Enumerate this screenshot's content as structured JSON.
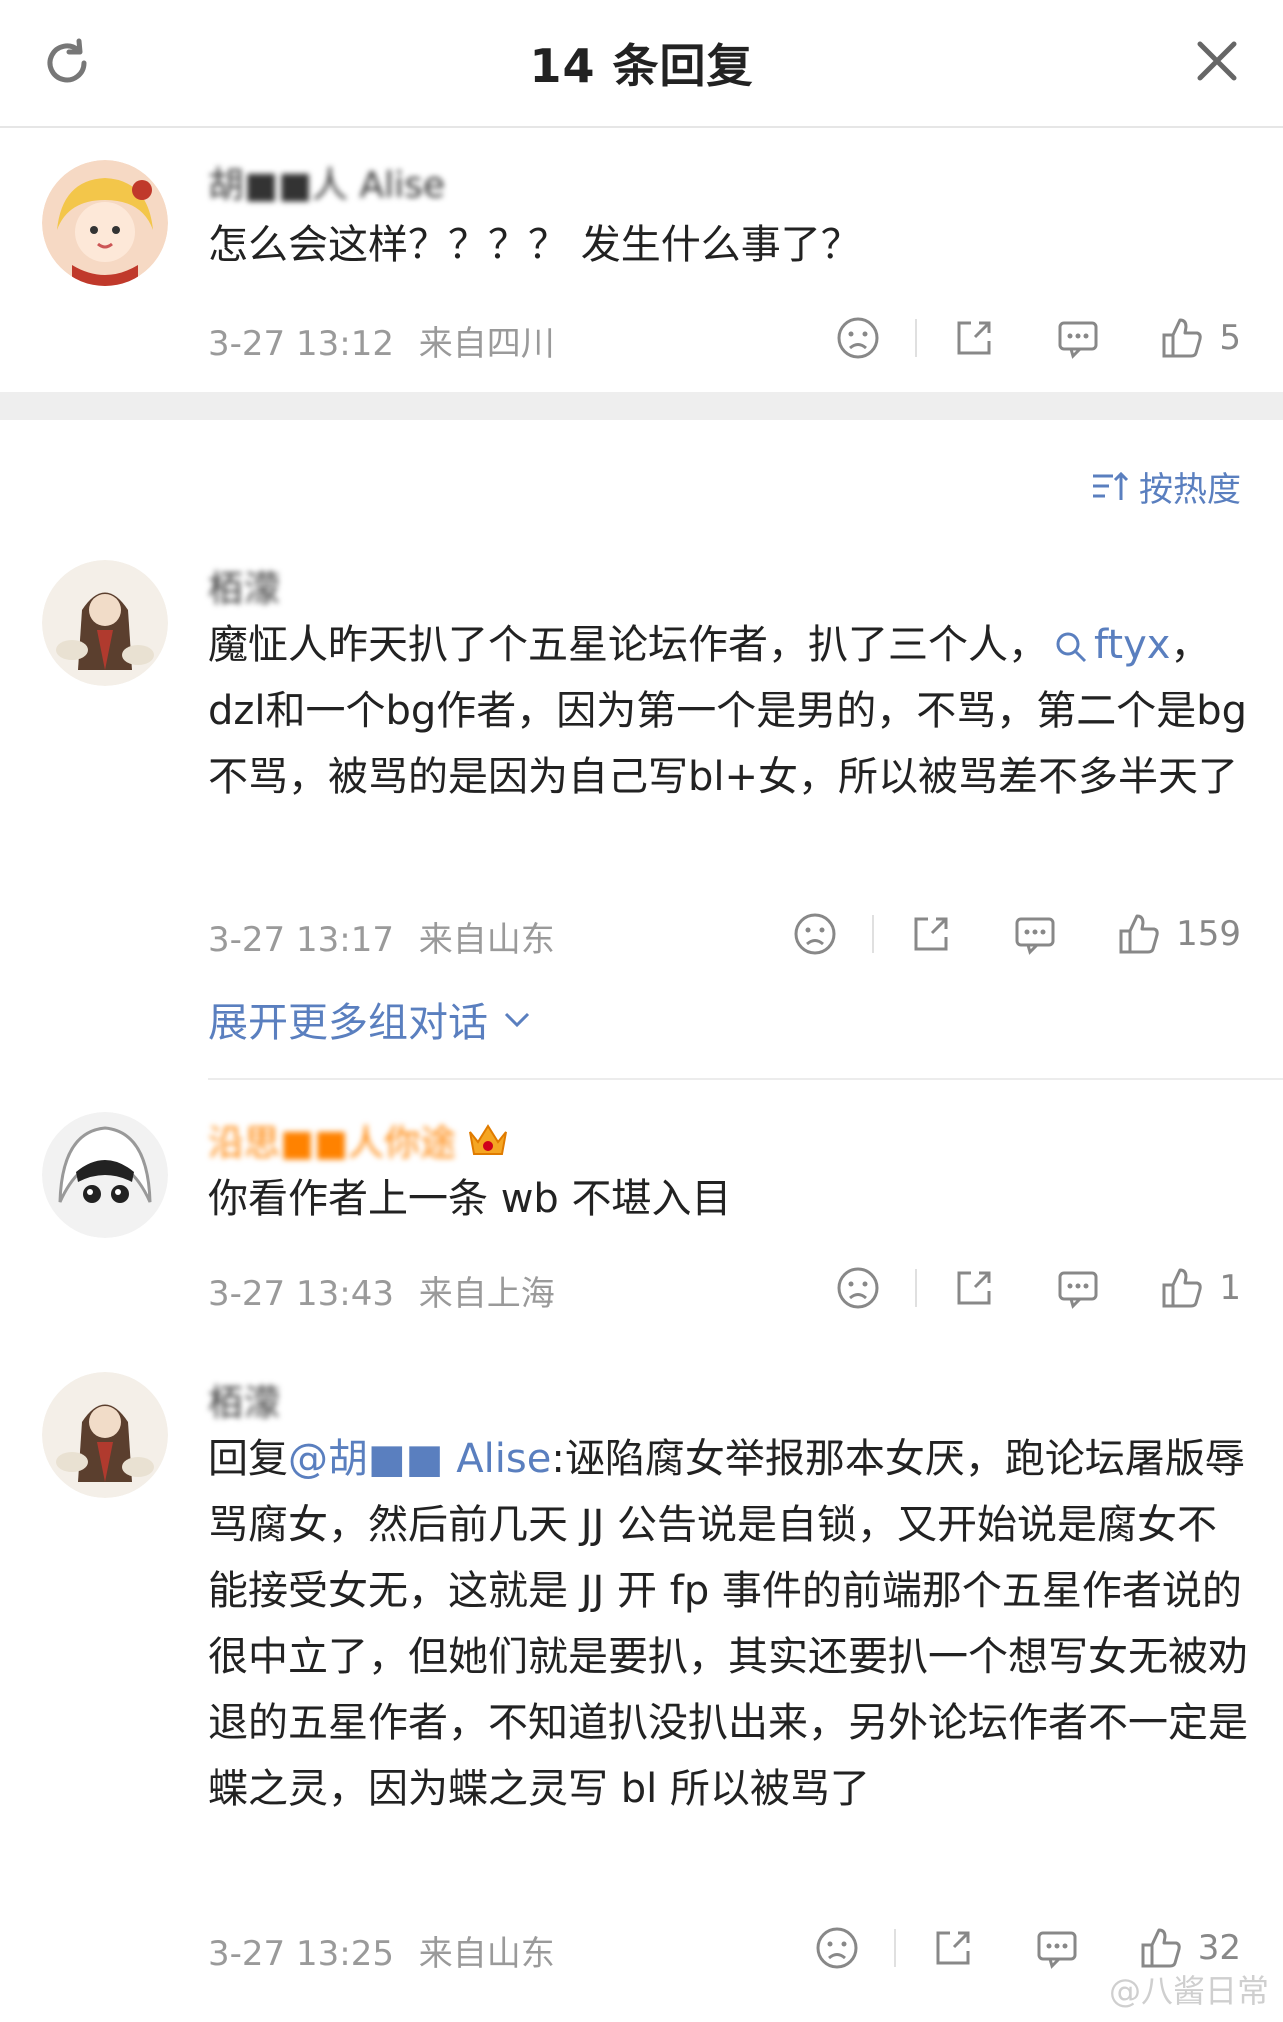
{
  "header": {
    "title": "14 条回复"
  },
  "root_comment": {
    "username": "胡■■人 Alise",
    "text": "怎么会这样？？？？ 发生什么事了？",
    "time": "3-27 13:12",
    "location": "来自四川",
    "likes": "5"
  },
  "sort": {
    "label": "按热度"
  },
  "replies": [
    {
      "username": "栢濛",
      "text_before": "魔怔人昨天扒了个五星论坛作者，扒了三个人，",
      "link": "ftyx",
      "text_after": "，dzl和一个bg作者，因为第一个是男的，不骂，第二个是bg不骂，被骂的是因为自己写bl+女，所以被骂差不多半天了",
      "time": "3-27 13:17",
      "location": "来自山东",
      "likes": "159",
      "expand": "展开更多组对话"
    },
    {
      "username": "沿思■■人你途",
      "text": "你看作者上一条 wb 不堪入目",
      "time": "3-27 13:43",
      "location": "来自上海",
      "likes": "1"
    },
    {
      "username": "栢濛",
      "reply_prefix": "回复",
      "mention": "@胡■■ Alise",
      "text": ":诬陷腐女举报那本女厌，跑论坛屠版辱骂腐女，然后前几天 JJ 公告说是自锁，又开始说是腐女不能接受女无，这就是 JJ 开 fp 事件的前端那个五星作者说的很中立了，但她们就是要扒，其实还要扒一个想写女无被劝退的五星作者，不知道扒没扒出来，另外论坛作者不一定是蝶之灵，因为蝶之灵写 bl 所以被骂了",
      "time": "3-27 13:25",
      "location": "来自山东",
      "likes": "32"
    }
  ],
  "watermark": "@八酱日常",
  "colors": {
    "link": "#5a7fbf",
    "orange_name": "#ff8200",
    "meta": "#9a9a9a"
  }
}
